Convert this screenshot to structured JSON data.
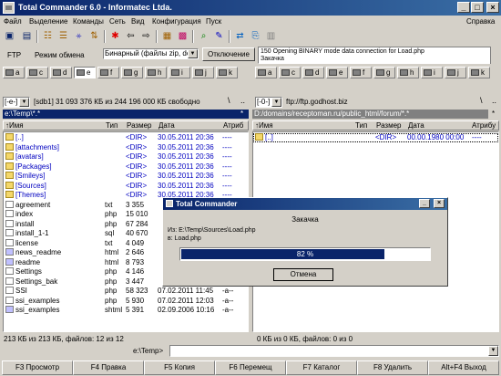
{
  "window": {
    "title": "Total Commander 6.0 - Informatec Ltda.",
    "min": "_",
    "max": "□",
    "close": "×"
  },
  "menu": {
    "items": [
      "Файл",
      "Выделение",
      "Команды",
      "Сеть",
      "Вид",
      "Конфигурация",
      "Пуск"
    ],
    "help": "Справка"
  },
  "ftp": {
    "label": "FTP",
    "mode_label": "Режим обмена",
    "mode_value": "Бинарный (файлы zip, doc",
    "disconnect": "Отключение",
    "log": [
      "150 Opening BINARY mode data connection for Load.php",
      "Закачка"
    ]
  },
  "left": {
    "drive_combo": "[-e-]",
    "drive_info": "[sdb1]  31 093 376 КБ из 244 196 000 КБ свободно",
    "path": "e:\\Temp\\*.*",
    "headers": {
      "name": "↑Имя",
      "ext": "Тип",
      "size": "Размер",
      "date": "Дата",
      "attr": "Атриб"
    },
    "files": [
      {
        "name": "[..]",
        "ext": "",
        "size": "<DIR>",
        "date": "30.05.2011 20:36",
        "attr": "----",
        "kind": "up"
      },
      {
        "name": "[attachments]",
        "ext": "",
        "size": "<DIR>",
        "date": "30.05.2011 20:36",
        "attr": "----",
        "kind": "dir"
      },
      {
        "name": "[avatars]",
        "ext": "",
        "size": "<DIR>",
        "date": "30.05.2011 20:36",
        "attr": "----",
        "kind": "dir"
      },
      {
        "name": "[Packages]",
        "ext": "",
        "size": "<DIR>",
        "date": "30.05.2011 20:36",
        "attr": "----",
        "kind": "dir"
      },
      {
        "name": "[Smileys]",
        "ext": "",
        "size": "<DIR>",
        "date": "30.05.2011 20:36",
        "attr": "----",
        "kind": "dir"
      },
      {
        "name": "[Sources]",
        "ext": "",
        "size": "<DIR>",
        "date": "30.05.2011 20:36",
        "attr": "----",
        "kind": "dir"
      },
      {
        "name": "[Themes]",
        "ext": "",
        "size": "<DIR>",
        "date": "30.05.2011 20:36",
        "attr": "----",
        "kind": "dir"
      },
      {
        "name": "agreement",
        "ext": "txt",
        "size": "3 355",
        "date": "",
        "attr": "",
        "kind": "file"
      },
      {
        "name": "index",
        "ext": "php",
        "size": "15 010",
        "date": "",
        "attr": "",
        "kind": "web"
      },
      {
        "name": "install",
        "ext": "php",
        "size": "67 284",
        "date": "",
        "attr": "",
        "kind": "web"
      },
      {
        "name": "install_1-1",
        "ext": "sql",
        "size": "40 670",
        "date": "",
        "attr": "",
        "kind": "file"
      },
      {
        "name": "license",
        "ext": "txt",
        "size": "4 049",
        "date": "",
        "attr": "",
        "kind": "file"
      },
      {
        "name": "news_readme",
        "ext": "html",
        "size": "2 646",
        "date": "",
        "attr": "",
        "kind": "exe"
      },
      {
        "name": "readme",
        "ext": "html",
        "size": "8 793",
        "date": "",
        "attr": "",
        "kind": "exe"
      },
      {
        "name": "Settings",
        "ext": "php",
        "size": "4 146",
        "date": "",
        "attr": "",
        "kind": "web"
      },
      {
        "name": "Settings_bak",
        "ext": "php",
        "size": "3 447",
        "date": "",
        "attr": "",
        "kind": "web"
      },
      {
        "name": "SSI",
        "ext": "php",
        "size": "58 323",
        "date": "07.02.2011 11:45",
        "attr": "-a--",
        "kind": "web"
      },
      {
        "name": "ssi_examples",
        "ext": "php",
        "size": "5 930",
        "date": "07.02.2011 12:03",
        "attr": "-a--",
        "kind": "web"
      },
      {
        "name": "ssi_examples",
        "ext": "shtml",
        "size": "5 391",
        "date": "02.09.2006 10:16",
        "attr": "-a--",
        "kind": "exe"
      }
    ],
    "status": "213 КБ из 213 КБ, файлов: 12 из 12"
  },
  "right": {
    "drive_combo": "[-0-]",
    "drive_info": "ftp://ftp.godhost.biz",
    "path": "D:/domains/receptoman.ru/public_html/forum/*.*",
    "headers": {
      "name": "↑Имя",
      "ext": "Тип",
      "size": "Размер",
      "date": "Дата",
      "attr": "Атрибу"
    },
    "files": [
      {
        "name": "[..]",
        "ext": "",
        "size": "<DIR>",
        "date": "00.00.1980 00:00",
        "attr": "----",
        "kind": "up"
      }
    ],
    "status": "0 КБ из 0 КБ, файлов: 0 из 0"
  },
  "drives_left": [
    "a",
    "c",
    "d",
    "e",
    "f",
    "g",
    "h",
    "i",
    "j",
    "k"
  ],
  "drives_right": [
    "a",
    "c",
    "d",
    "e",
    "f",
    "g",
    "h",
    "i",
    "j",
    "k"
  ],
  "dialog": {
    "title": "Total Commander",
    "heading": "Закачка",
    "from": "Из:  E:\\Temp\\Sources\\Load.php",
    "to": "в:  Load.php",
    "progress_label": "82 %",
    "progress": 0.82,
    "cancel": "Отмена"
  },
  "cmdline": {
    "prompt": "e:\\Temp>"
  },
  "fkeys": [
    "F3 Просмотр",
    "F4 Правка",
    "F5 Копия",
    "F6 Перемещ",
    "F7 Каталог",
    "F8 Удалить",
    "Alt+F4 Выход"
  ],
  "colors": {
    "titlebar": "#0a246a",
    "dir": "#0000c0",
    "face": "#d4d0c8"
  }
}
